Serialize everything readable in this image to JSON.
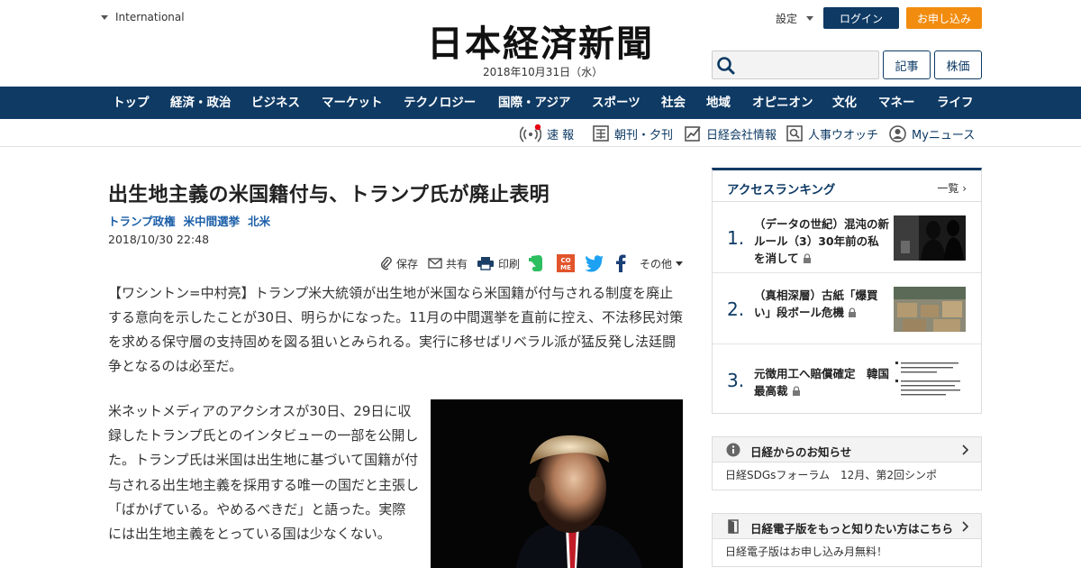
{
  "header": {
    "region": "International",
    "masthead": "日本経済新聞",
    "date": "2018年10月31日（水）",
    "settings": "設定",
    "login": "ログイン",
    "apply": "お申し込み",
    "search_icon": "search-icon",
    "articles_button": "記事",
    "stocks_button": "株価",
    "brand_color": "#0e3a64",
    "accent_color": "#f28c0f"
  },
  "nav": {
    "items": [
      "トップ",
      "経済・政治",
      "ビジネス",
      "マーケット",
      "テクノロジー",
      "国際・アジア",
      "スポーツ",
      "社会",
      "地域",
      "オピニオン",
      "文化",
      "マネー",
      "ライフ"
    ]
  },
  "subnav": {
    "items": [
      {
        "label": "速 報",
        "icon": "broadcast-icon"
      },
      {
        "label": "朝刊・夕刊",
        "icon": "newspaper-icon"
      },
      {
        "label": "日経会社情報",
        "icon": "chart-icon"
      },
      {
        "label": "人事ウオッチ",
        "icon": "magnifier-icon"
      },
      {
        "label": "Myニュース",
        "icon": "user-icon"
      }
    ]
  },
  "article": {
    "headline": "出生地主義の米国籍付与、トランプ氏が廃止表明",
    "tags": [
      "トランプ政権",
      "米中間選挙",
      "北米"
    ],
    "timestamp": "2018/10/30 22:48",
    "tools": {
      "save": "保存",
      "share": "共有",
      "print": "印刷",
      "more": "その他",
      "come_line1": "CO",
      "come_line2": "ME"
    },
    "lede": "【ワシントン=中村亮】トランプ米大統領が出生地が米国なら米国籍が付与される制度を廃止する意向を示したことが30日、明らかになった。11月の中間選挙を直前に控え、不法移民対策を求める保守層の支持固めを図る狙いとみられる。実行に移せばリベラル派が猛反発し法廷闘争となるのは必至だ。",
    "body": "米ネットメディアのアクシオスが30日、29日に収録したトランプ氏とのインタビューの一部を公開した。トランプ氏は米国は出生地に基づいて国籍が付与される出生地主義を採用する唯一の国だと主張し「ばかげている。やめるべきだ」と語った。実際には出生地主義をとっている国は少なくない。"
  },
  "ranking": {
    "title": "アクセスランキング",
    "all_link": "一覧",
    "items": [
      {
        "rank": "1.",
        "text": "（データの世紀）混沌の新ルール（3）30年前の私を消して"
      },
      {
        "rank": "2.",
        "text": "（真相深層）古紙「爆買い」段ボール危機"
      },
      {
        "rank": "3.",
        "text": "元徴用工へ賠償確定　韓国最高裁"
      }
    ]
  },
  "notice_box": {
    "title": "日経からのお知らせ",
    "body": "日経SDGsフォーラム　12月、第2回シンポ"
  },
  "digital_box": {
    "title": "日経電子版をもっと知りたい方はこちら",
    "body": "日経電子版はお申し込み月無料！"
  }
}
